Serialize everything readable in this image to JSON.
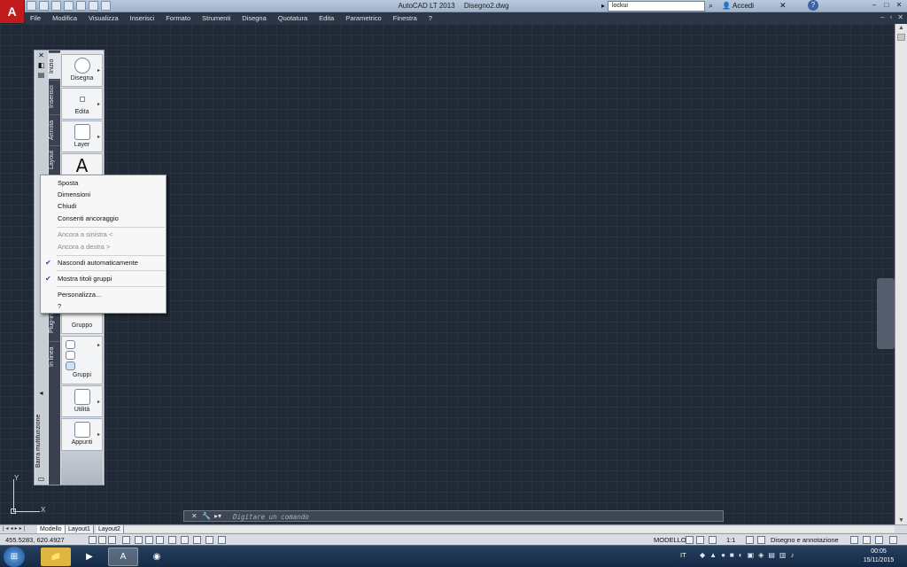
{
  "app": {
    "logo": "A",
    "title": "AutoCAD LT 2013",
    "document": "Disegno2.dwg",
    "search_value": "lockui",
    "signin_label": "Accedi",
    "help_label": "?"
  },
  "menubar": {
    "items": [
      "File",
      "Modifica",
      "Visualizza",
      "Inserisci",
      "Formato",
      "Strumenti",
      "Disegna",
      "Quotatura",
      "Edita",
      "Parametrico",
      "Finestra",
      "?"
    ]
  },
  "ribbon": {
    "palette_title": "Barra multifunzione",
    "tabs": [
      "Inizio",
      "Inserisci",
      "Annota",
      "Layout",
      "Plug-in",
      "In linea"
    ],
    "panels": {
      "draw": "Disegna",
      "edit": "Edita",
      "layer": "Layer",
      "annotation_glyph": "A",
      "group": "Gruppo",
      "groups": "Gruppi",
      "utilities": "Utilità",
      "clipboard": "Appunti"
    }
  },
  "context_menu": {
    "items": [
      {
        "label": "Sposta",
        "enabled": true,
        "checked": false
      },
      {
        "label": "Dimensioni",
        "enabled": true,
        "checked": false
      },
      {
        "label": "Chiudi",
        "enabled": true,
        "checked": false
      },
      {
        "label": "Consenti ancoraggio",
        "enabled": true,
        "checked": false
      },
      {
        "label": "Ancora a sinistra  <",
        "enabled": false,
        "checked": false
      },
      {
        "label": "Ancora a destra  >",
        "enabled": false,
        "checked": false
      },
      {
        "label": "Nascondi automaticamente",
        "enabled": true,
        "checked": true
      },
      {
        "label": "Mostra titoli gruppi",
        "enabled": true,
        "checked": true
      },
      {
        "label": "Personalizza...",
        "enabled": true,
        "checked": false
      },
      {
        "label": "?",
        "enabled": true,
        "checked": false
      }
    ]
  },
  "ucs": {
    "x": "X",
    "y": "Y"
  },
  "command_line": {
    "placeholder": "Digitare un comando"
  },
  "layout_tabs": [
    "Modello",
    "Layout1",
    "Layout2"
  ],
  "status": {
    "coords": "455.5283, 620.4927",
    "space": "MODELLO",
    "scale": "1:1",
    "workspace": "Disegno e annotazione"
  },
  "taskbar": {
    "lang": "IT",
    "time": "00:05",
    "date": "15/11/2015"
  },
  "colors": {
    "canvas": "#212936",
    "logo": "#c21b1b",
    "accent": "#23469b"
  }
}
